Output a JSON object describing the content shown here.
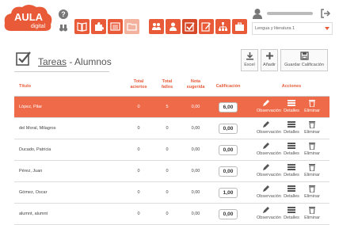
{
  "header": {
    "logo_line1": "AULA",
    "logo_line2": "digital",
    "help_icon_text": "?",
    "subject_select": "Lengua y literatura 1"
  },
  "page": {
    "title_link": "Tareas",
    "title_rest": " - Alumnos"
  },
  "actions": {
    "excel_label": "Excel",
    "add_label": "Añadir",
    "save_label": "Guardar Calificación"
  },
  "table": {
    "headers": {
      "title": "Título",
      "correct_1": "Total",
      "correct_2": "aciertos",
      "fails_1": "Total",
      "fails_2": "fallos",
      "suggested_1": "Nota",
      "suggested_2": "sugerida",
      "grade": "Calificación",
      "actions": "Acciones"
    },
    "action_labels": {
      "obs": "Observación",
      "details": "Detalles",
      "delete": "Eliminar"
    },
    "rows": [
      {
        "name": "López, Pilar",
        "correct": "0",
        "fails": "5",
        "suggested": "0,00",
        "grade": "6,00"
      },
      {
        "name": "del Moral, Milagros",
        "correct": "0",
        "fails": "0",
        "suggested": "0,00",
        "grade": "0,00"
      },
      {
        "name": "Ducado, Patricia",
        "correct": "0",
        "fails": "0",
        "suggested": "0,00",
        "grade": "0,00"
      },
      {
        "name": "Pérez, Juan",
        "correct": "0",
        "fails": "0",
        "suggested": "0,00",
        "grade": "0,00"
      },
      {
        "name": "Gómez, Oscar",
        "correct": "0",
        "fails": "0",
        "suggested": "0,00",
        "grade": "1,00"
      },
      {
        "name": "alumnt, alumnt",
        "correct": "0",
        "fails": "0",
        "suggested": "0,00",
        "grade": "0,00"
      }
    ]
  },
  "colors": {
    "accent": "#e85a38",
    "selected_row": "#ee6a49"
  }
}
